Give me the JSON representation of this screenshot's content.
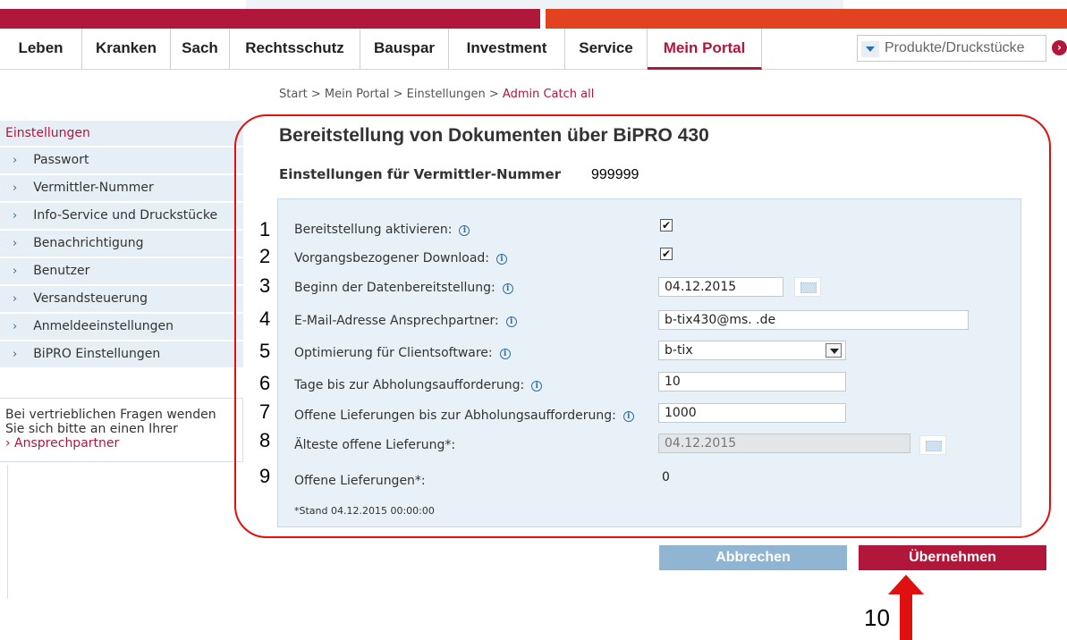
{
  "nav": {
    "items": [
      "Leben",
      "Kranken",
      "Sach",
      "Rechtsschutz",
      "Bauspar",
      "Investment",
      "Service",
      "Mein Portal"
    ],
    "search_placeholder": "Produkte/Druckstücke",
    "go_icon": "chevron-right-icon"
  },
  "breadcrumb": {
    "path": "Start > Mein Portal > Einstellungen > ",
    "current": "Admin Catch all"
  },
  "sidebar": {
    "heading": "Einstellungen",
    "items": [
      "Passwort",
      "Vermittler-Nummer",
      "Info-Service und Druckstücke",
      "Benachrichtigung",
      "Benutzer",
      "Versandsteuerung",
      "Anmeldeeinstellungen",
      "BiPRO Einstellungen"
    ],
    "chevron": "›",
    "contact_text_1": "Bei vertrieblichen Fragen wenden",
    "contact_text_2": "Sie sich bitte an einen Ihrer",
    "contact_link": "› Ansprechpartner"
  },
  "panel": {
    "title": "Bereitstellung von Dokumenten über BiPRO 430",
    "subtitle": "Einstellungen für Vermittler-Nummer",
    "vermittler_nummer": "999999"
  },
  "form": {
    "info_glyph": "i",
    "rows": [
      {
        "num": "1",
        "label": "Bereitstellung aktivieren:",
        "checked": "✔"
      },
      {
        "num": "2",
        "label": "Vorgangsbezogener Download:",
        "checked": "✔"
      },
      {
        "num": "3",
        "label": "Beginn der Datenbereitstellung:",
        "value": "04.12.2015"
      },
      {
        "num": "4",
        "label": "E-Mail-Adresse Ansprechpartner:",
        "value": "b-tix430@ms.         .de"
      },
      {
        "num": "5",
        "label": "Optimierung für Clientsoftware:",
        "value": "b-tix"
      },
      {
        "num": "6",
        "label": "Tage bis zur Abholungsaufforderung:",
        "value": "10"
      },
      {
        "num": "7",
        "label": "Offene Lieferungen bis zur Abholungsaufforderung:",
        "value": "1000"
      },
      {
        "num": "8",
        "label": "Älteste offene Lieferung*:",
        "value": "04.12.2015"
      },
      {
        "num": "9",
        "label": "Offene Lieferungen*:",
        "value": "0"
      }
    ],
    "footnote": "*Stand 04.12.2015 00:00:00"
  },
  "buttons": {
    "cancel": "Abbrechen",
    "apply": "Übernehmen"
  },
  "annotation": {
    "label": "10",
    "color": "#e01010"
  },
  "colors": {
    "brand_red": "#b0173a",
    "accent_orange": "#e2421f",
    "panel_blue": "#e8f1f7",
    "button_blue": "#8fb5d2"
  }
}
